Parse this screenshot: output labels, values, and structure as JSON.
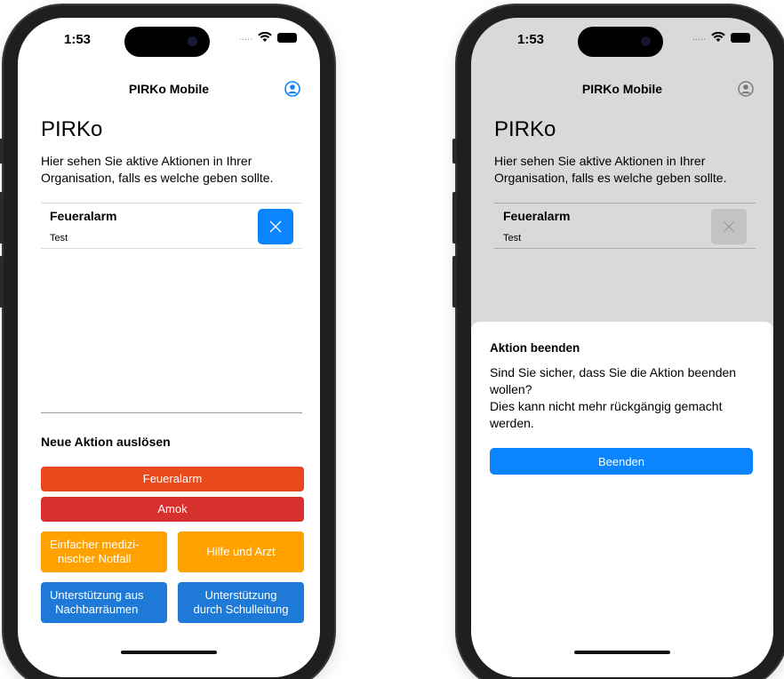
{
  "status": {
    "time": "1:53",
    "signal": "....."
  },
  "nav": {
    "title": "PIRKo Mobile"
  },
  "main": {
    "title": "PIRKo",
    "intro": "Hier sehen Sie aktive Aktionen in Ihrer Organisation, falls es welche geben sollte.",
    "active_action": {
      "title": "Feueralarm",
      "description": "Test"
    }
  },
  "new_action": {
    "section_title": "Neue Aktion auslösen",
    "buttons": {
      "fire": "Feueralarm",
      "amok": "Amok",
      "medical": "Einfacher medizi-\nnischer Notfall",
      "help_doctor": "Hilfe und Arzt",
      "neighbor": "Unterstützung aus\nNachbarräumen",
      "principal": "Unterstützung\ndurch Schulleitung"
    }
  },
  "sheet": {
    "title": "Aktion beenden",
    "message": "Sind Sie sicher, dass Sie die Aktion beenden wollen?\nDies kann nicht mehr rückgängig gemacht werden.",
    "confirm": "Beenden"
  },
  "colors": {
    "accent": "#0a84ff",
    "fire": "#e8491d",
    "amok": "#d7312d",
    "warning": "#ffa200",
    "support": "#1e7ad6"
  },
  "icons": [
    "profile-icon",
    "close-icon",
    "wifi-icon",
    "battery-icon"
  ]
}
